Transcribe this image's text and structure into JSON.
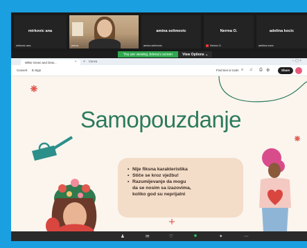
{
  "participants": [
    {
      "name": "mirkovic ana",
      "label": "mirkovic ana",
      "muted": false
    },
    {
      "name": "",
      "label": "jelena",
      "muted": false,
      "video": true
    },
    {
      "name": "amina selimovic",
      "label": "amina selimovic",
      "muted": false
    },
    {
      "name": "Nerma O.",
      "label": "Nerma O.",
      "muted": true
    },
    {
      "name": "adelina kocic",
      "label": "adelina kocic",
      "muted": false
    }
  ],
  "banner": {
    "viewing": "You are viewing Jelena's screen",
    "options": "View Options"
  },
  "browser": {
    "tab_title": "White Green and Oran...",
    "tab2_title": "Canva",
    "new_tab": "+",
    "toolbar": {
      "convert": "Convert",
      "esign": "E-Sign",
      "find": "Find text or tools",
      "share": "Share"
    }
  },
  "slide": {
    "title": "Samopouzdanje",
    "bullets": [
      "Nije fiksna karakteristika",
      "Stiče se kroz vježbu!",
      "Razumijevanje da mogu",
      "da se nosim sa izazovima,",
      "koliko god su neprijatni"
    ],
    "bullet_markers": [
      true,
      true,
      true,
      false,
      false
    ]
  },
  "colors": {
    "outer_background": "#1a9fe0",
    "title_green": "#2c7a5c",
    "banner_green": "#2fa84f",
    "bullet_box": "#f3dcc8"
  }
}
